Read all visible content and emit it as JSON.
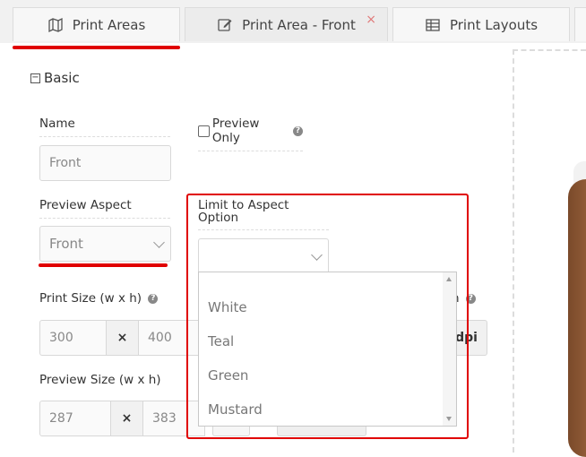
{
  "tabs": [
    {
      "label": "Print Areas",
      "icon": "map-icon"
    },
    {
      "label": "Print Area - Front",
      "icon": "edit-icon",
      "close": "×"
    },
    {
      "label": "Print Layouts",
      "icon": "table-icon"
    }
  ],
  "section": {
    "toggle": "−",
    "title": "Basic"
  },
  "name": {
    "label": "Name",
    "value": "Front"
  },
  "preview_only": {
    "label": "Preview Only",
    "checked": false,
    "help": "?"
  },
  "preview_aspect": {
    "label": "Preview Aspect",
    "value": "Front"
  },
  "limit_aspect": {
    "label_line1": "Limit to Aspect",
    "label_line2": "Option",
    "value": ""
  },
  "print_size": {
    "label": "Print Size (w x h)",
    "help": "?",
    "width": "300",
    "times": "×",
    "height": "400"
  },
  "dpi": {
    "addon": "dpi",
    "help": "?",
    "label_fragment": "n"
  },
  "preview_size": {
    "label": "Preview Size (w x h)",
    "width": "287",
    "times": "×",
    "height": "383"
  },
  "dropdown_options": [
    "White",
    "Teal",
    "Green",
    "Mustard"
  ],
  "colors": {
    "accent_red": "#e00000",
    "tab_bg": "#f1f1f1"
  }
}
